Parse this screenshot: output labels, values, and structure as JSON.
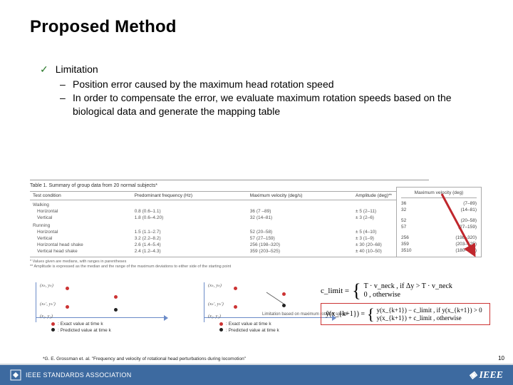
{
  "title": "Proposed Method",
  "bullet": {
    "main": "Limitation",
    "subs": [
      "Position error caused by the maximum head rotation speed",
      "In order to compensate the error, we evaluate maximum rotation speeds based on the biological data and generate the mapping table"
    ]
  },
  "table": {
    "caption": "Table 1. Summary of group data from 20 normal subjects*",
    "headers": [
      "Test condition",
      "Predominant frequency (Hz)",
      "Maximum velocity (deg/s)",
      "Amplitude (deg)**"
    ],
    "groups": [
      {
        "name": "Walking",
        "rows": [
          {
            "label": "Horizontal",
            "freq": "0.8 (0.6–1.1)",
            "vel": "36 (7 –89)",
            "amp": "± 5 (2–11)"
          },
          {
            "label": "Vertical",
            "freq": "1.8 (0.6–4.20)",
            "vel": "32 (14–81)",
            "amp": "± 3 (2–6)"
          }
        ]
      },
      {
        "name": "Running",
        "rows": [
          {
            "label": "Horizontal",
            "freq": "1.5 (1.1–2.7)",
            "vel": "52 (20–58)",
            "amp": "± 5 (4–10)"
          },
          {
            "label": "Vertical",
            "freq": "3.2 (2.2–8.2)",
            "vel": "57 (27–159)",
            "amp": "± 3 (1–9)"
          }
        ]
      },
      {
        "name": "",
        "rows": [
          {
            "label": "Horizontal head shake",
            "freq": "2.6 (1.4–5.4)",
            "vel": "256 (198–320)",
            "amp": "± 30 (20–68)"
          },
          {
            "label": "Vertical head shake",
            "freq": "2.4 (1.2–4.3)",
            "vel": "359 (203–525)",
            "amp": "± 40 (10–50)"
          }
        ]
      }
    ],
    "notes": [
      "* Values given are medians, with ranges in parentheses",
      "** Amplitude is expressed as the median and the range of the maximum deviations to either side of the starting point"
    ]
  },
  "mvbox": {
    "header": "Maximum velocity (deg)",
    "rows": [
      {
        "l": "36",
        "r": "(7–89)"
      },
      {
        "l": "32",
        "r": "(14–81)"
      },
      {
        "l": "",
        "r": ""
      },
      {
        "l": "52",
        "r": "(20–58)"
      },
      {
        "l": "57",
        "r": "(27–159)"
      },
      {
        "l": "",
        "r": ""
      },
      {
        "l": "256",
        "r": "(198–320)"
      },
      {
        "l": "359",
        "r": "(203–525)"
      },
      {
        "l": "3510",
        "r": "(180–700)"
      }
    ]
  },
  "plots": {
    "labels": {
      "xk_yk": "(xₖ, yₖ)",
      "xk1_yk1": "(xₖ′, yₖ′)",
      "x2_y2": "(x₂, y₂)"
    },
    "legend": {
      "red": ": Exact value at time k",
      "black": ": Predicted value at time k"
    },
    "lim_text": "Limitation based on maximum rotation speed"
  },
  "equations": {
    "eq1": {
      "lhs": "c_limit =",
      "case1": "T · v_neck , if Δy > T · v_neck",
      "case2": "0 , otherwise"
    },
    "eq2": {
      "lhs": "ŷ(x_{k+1}) =",
      "case1": "y(x_{k+1}) − c_limit , if y(x_{k+1}) > 0",
      "case2": "y(x_{k+1}) + c_limit , otherwise"
    }
  },
  "reference": "*G. E. Grossman et. al. \"Frequency and velocity of rotational head perturbations during locomotion\"",
  "footer": {
    "left": "IEEE STANDARDS ASSOCIATION",
    "right": "IEEE"
  },
  "page_number": "10"
}
